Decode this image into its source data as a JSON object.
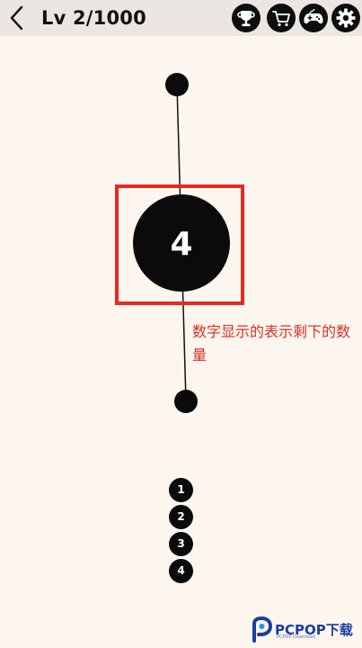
{
  "header": {
    "level_text": "Lv 2/1000",
    "icons": [
      "back-chevron-icon",
      "trophy-icon",
      "cart-icon",
      "gamepad-icon",
      "gear-icon"
    ]
  },
  "game": {
    "center_ball_label": "4",
    "queue": [
      "1",
      "2",
      "3",
      "4"
    ]
  },
  "annotation": {
    "text": "数字显示的表示剩下的数量",
    "color": "#e52a22"
  },
  "watermark": {
    "brand": "PCPOP下载",
    "sub": "PCPOP Download"
  },
  "colors": {
    "background": "#fdf6ef",
    "topbar": "#ebe6e1",
    "ball": "#0b0b0b"
  }
}
